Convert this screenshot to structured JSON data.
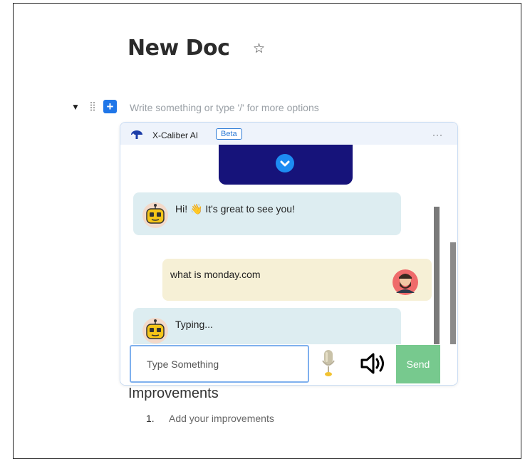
{
  "doc": {
    "title": "New Doc",
    "block_placeholder": "Write something or type '/' for more options",
    "add_block_label": "+"
  },
  "chat": {
    "app_name": "X-Caliber AI",
    "badge": "Beta",
    "more_label": "···",
    "messages": [
      {
        "role": "bot",
        "text": "Hi! 👋 It's great to see you!"
      },
      {
        "role": "user",
        "text": "what is monday.com"
      },
      {
        "role": "bot",
        "text": "Typing..."
      }
    ],
    "input_placeholder": "Type Something",
    "send_label": "Send"
  },
  "section": {
    "heading": "Improvements",
    "items": [
      {
        "number": "1.",
        "text": "Add your improvements"
      }
    ]
  },
  "colors": {
    "add_button": "#1f76e8",
    "send_button": "#77c98e",
    "bot_bubble": "#ddedf1",
    "user_bubble": "#f6f0d6",
    "media_card": "#16137a"
  }
}
